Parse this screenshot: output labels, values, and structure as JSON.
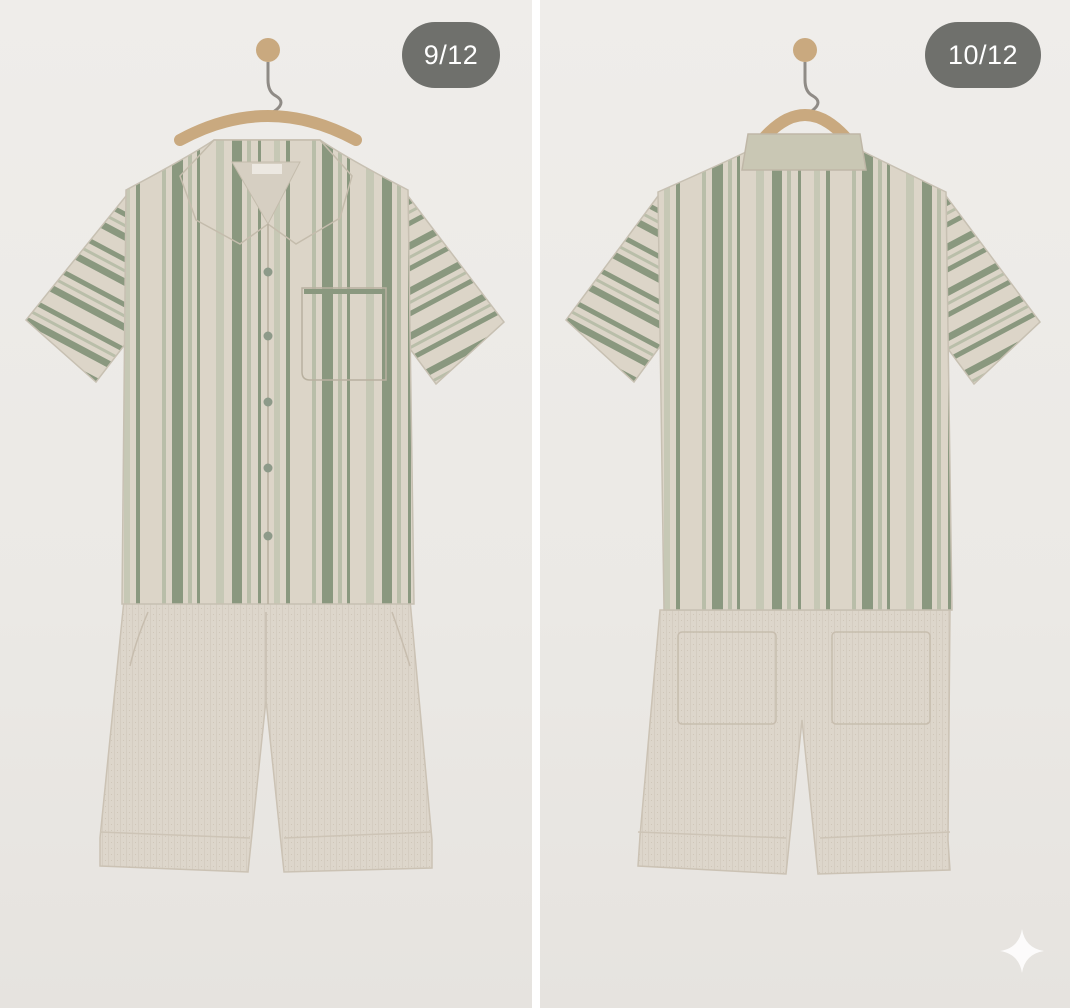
{
  "gallery": {
    "images": [
      {
        "counter": "9/12",
        "view": "front"
      },
      {
        "counter": "10/12",
        "view": "back"
      }
    ]
  },
  "icons": {
    "watermark": "sparkle-icon"
  },
  "colors": {
    "background": "#ece9e5",
    "fabric": "#dcd5c8",
    "stripe_green": "#8a987f",
    "stripe_light": "#b9bea9",
    "shorts": "#ddd6cb",
    "counter_bg": "#6f706c"
  }
}
